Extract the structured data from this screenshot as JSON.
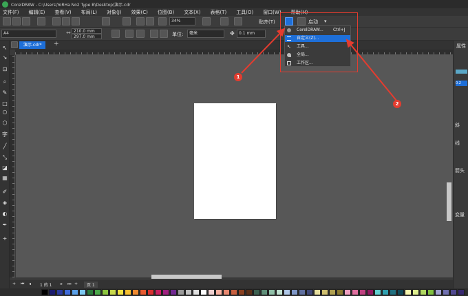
{
  "window": {
    "title": "CorelDRAW - C:\\Users\\YoRHa No2 Type B\\Desktop\\演示.cdr"
  },
  "menu": [
    "文件(F)",
    "编辑(E)",
    "查看(V)",
    "布局(L)",
    "对象(J)",
    "效果(C)",
    "位图(B)",
    "文本(X)",
    "表格(T)",
    "工具(O)",
    "窗口(W)",
    "帮助(H)"
  ],
  "toolbar": {
    "zoom": "34%",
    "snap_label": "贴齐(T)",
    "startup_label": "启动",
    "page_size": "A4",
    "width": "210.0 mm",
    "height": "297.0 mm",
    "units_label": "单位:",
    "units_value": "毫米",
    "nudge": "0.1 mm"
  },
  "tabs": {
    "document": "演示.cdr*",
    "add": "+"
  },
  "options_menu": {
    "items": [
      {
        "label": "CorelDRAW...",
        "shortcut": "Ctrl+J",
        "icon": "coreldraw-icon",
        "selected": false
      },
      {
        "label": "自定义(Z)...",
        "shortcut": "",
        "icon": "customize-icon",
        "selected": true
      },
      {
        "label": "工具...",
        "shortcut": "",
        "icon": "tools-icon",
        "selected": false
      },
      {
        "label": "全局...",
        "shortcut": "",
        "icon": "global-icon",
        "selected": false
      },
      {
        "label": "工作区...",
        "shortcut": "",
        "icon": "workspace-icon",
        "selected": false
      }
    ]
  },
  "annotations": {
    "step1": "1",
    "step2": "2"
  },
  "docker": {
    "title": "属性",
    "field_value": "0.2 mm",
    "labels": [
      "斜",
      "线",
      "箭头",
      "变量"
    ]
  },
  "status": {
    "page_info": "1 的 1",
    "page_tab": "页 1"
  },
  "palette": [
    "#000000",
    "#1a1a6e",
    "#2b3a9f",
    "#3f6ad8",
    "#5aa0e8",
    "#7cc8f0",
    "#2a7a3a",
    "#4aa84a",
    "#8cc63f",
    "#c8d84a",
    "#f0e040",
    "#f8c030",
    "#f08a30",
    "#e85a30",
    "#d83030",
    "#c82060",
    "#a02080",
    "#702890",
    "#9a9a9a",
    "#c0c0c0",
    "#e0e0e0",
    "#ffffff",
    "#f0d0d0",
    "#f8b0a0",
    "#e88870",
    "#c86040",
    "#8a4020",
    "#5a3018",
    "#3c6050",
    "#60907a",
    "#90c0a8",
    "#c0e0d0",
    "#b0c8e8",
    "#8098c8",
    "#6070a0",
    "#404878",
    "#e8e0a0",
    "#d0c070",
    "#b0a050",
    "#8a7a30",
    "#f0a0c0",
    "#e070a0",
    "#c04080",
    "#901860",
    "#60d0d0",
    "#30a0b0",
    "#207080",
    "#104858",
    "#f8f8b0",
    "#e0f090",
    "#b0d860",
    "#80c040",
    "#a0a0d0",
    "#7070b0",
    "#504890",
    "#382870"
  ]
}
